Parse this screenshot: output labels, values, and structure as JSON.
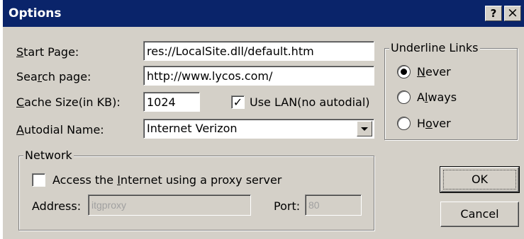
{
  "window": {
    "title": "Options",
    "help_glyph": "?",
    "close_glyph": "×"
  },
  "fields": {
    "start_page": {
      "label_pre": "",
      "label_key": "S",
      "label_post": "tart Page:",
      "value": "res://LocalSite.dll/default.htm"
    },
    "search_page": {
      "label_pre": "Sea",
      "label_key": "r",
      "label_post": "ch page:",
      "value": "http://www.lycos.com/"
    },
    "cache_size": {
      "label_pre": "",
      "label_key": "C",
      "label_post": "ache Size(in KB):",
      "value": "1024"
    },
    "autodial": {
      "label_pre": "",
      "label_key": "A",
      "label_post": "utodial Name:",
      "value": "Internet Verizon"
    }
  },
  "use_lan": {
    "label": "Use LAN(no autodial)",
    "checked": true,
    "check_glyph": "✓"
  },
  "network": {
    "title": "Network",
    "proxy": {
      "label_pre": "Access the ",
      "label_key": "I",
      "label_post": "nternet using a proxy server",
      "checked": false
    },
    "address_label": "Address:",
    "address_value": "itgproxy",
    "port_label": "Port:",
    "port_value": "80"
  },
  "underline_links": {
    "title": "Underline Links",
    "options": [
      {
        "label_pre": "",
        "label_key": "N",
        "label_post": "ever",
        "checked": true
      },
      {
        "label_pre": "A",
        "label_key": "l",
        "label_post": "ways",
        "checked": false
      },
      {
        "label_pre": "H",
        "label_key": "o",
        "label_post": "ver",
        "checked": false
      }
    ]
  },
  "buttons": {
    "ok": "OK",
    "cancel": "Cancel"
  },
  "colors": {
    "titlebar": "#0a246a",
    "face": "#d4d0c8"
  }
}
